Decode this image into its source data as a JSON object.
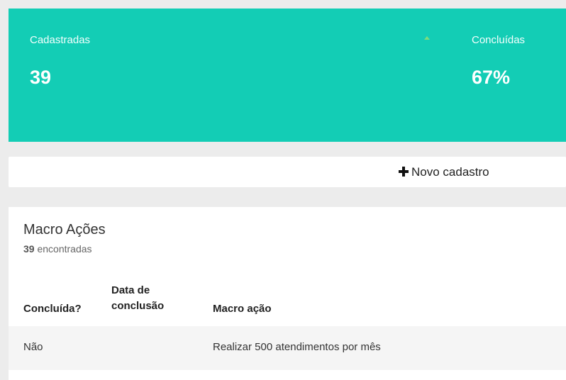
{
  "stats": {
    "registered": {
      "label": "Cadastradas",
      "value": "39"
    },
    "completed": {
      "label": "Concluídas",
      "value": "67%"
    }
  },
  "toolbar": {
    "new_label": "Novo cadastro"
  },
  "panel": {
    "title": "Macro Ações",
    "count": "39",
    "count_suffix": "encontradas"
  },
  "table": {
    "headers": {
      "done": "Concluída?",
      "date_line1": "Data de",
      "date_line2": "conclusão",
      "action": "Macro ação"
    },
    "rows": [
      {
        "done": "Não",
        "date": "",
        "action": "Realizar 500 atendimentos por mês"
      }
    ]
  },
  "colors": {
    "accent": "#13cdb5",
    "background": "#ececec"
  }
}
